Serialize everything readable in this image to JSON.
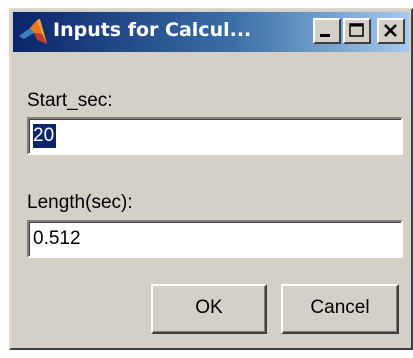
{
  "window": {
    "title": "Inputs for Calcul...",
    "controls": {
      "minimize": "minimize",
      "maximize": "maximize",
      "close": "close"
    }
  },
  "icons": {
    "app": "matlab-logo-icon"
  },
  "fields": [
    {
      "label": "Start_sec:",
      "value": "20",
      "selected": true
    },
    {
      "label": "Length(sec):",
      "value": "0.512",
      "selected": false
    }
  ],
  "buttons": {
    "ok": "OK",
    "cancel": "Cancel"
  },
  "colors": {
    "titlebar_start": "#0a246a",
    "titlebar_end": "#a6caf0",
    "selection": "#0a246a",
    "face": "#d4d0c8"
  }
}
